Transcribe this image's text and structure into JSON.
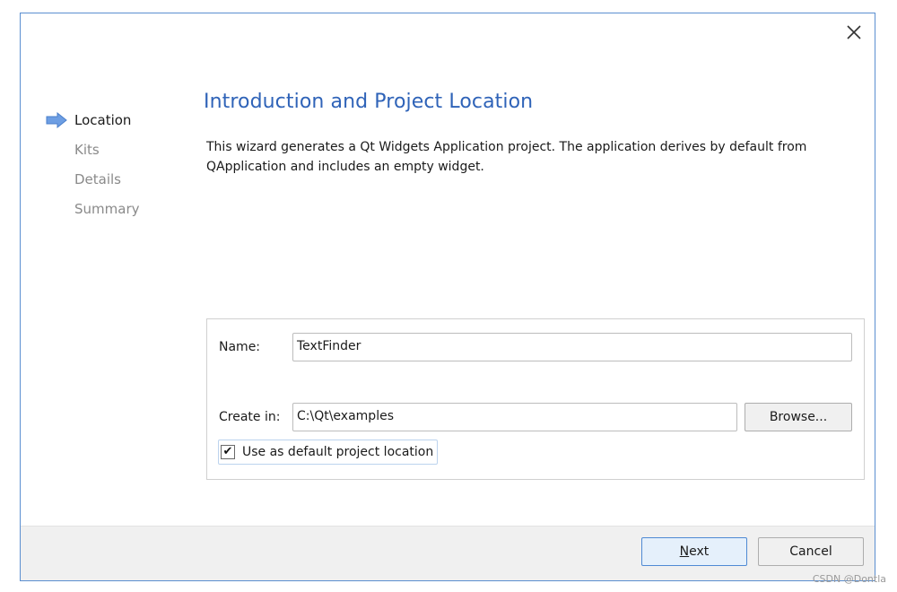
{
  "wizard": {
    "steps": [
      {
        "label": "Location",
        "active": true
      },
      {
        "label": "Kits",
        "active": false
      },
      {
        "label": "Details",
        "active": false
      },
      {
        "label": "Summary",
        "active": false
      }
    ],
    "title": "Introduction and Project Location",
    "description": "This wizard generates a Qt Widgets Application project. The application derives by default from QApplication and includes an empty widget."
  },
  "form": {
    "name_label": "Name:",
    "name_value": "TextFinder",
    "create_in_label": "Create in:",
    "create_in_value": "C:\\Qt\\examples",
    "browse_label": "Browse...",
    "default_location_label": "Use as default project location",
    "default_location_checked": true
  },
  "footer": {
    "next_mnemonic": "N",
    "next_rest": "ext",
    "cancel_label": "Cancel"
  },
  "icons": {
    "close": "close-icon",
    "step_arrow": "arrow-right-icon",
    "check": "checkmark-icon"
  },
  "colors": {
    "title": "#2f63b8",
    "dialog_border": "#5b8fd0",
    "step_arrow": "#6d9ee3",
    "inactive_step": "#8a8a8a",
    "footer_bg": "#f0f0f0"
  },
  "watermark": "CSDN @Dontla"
}
